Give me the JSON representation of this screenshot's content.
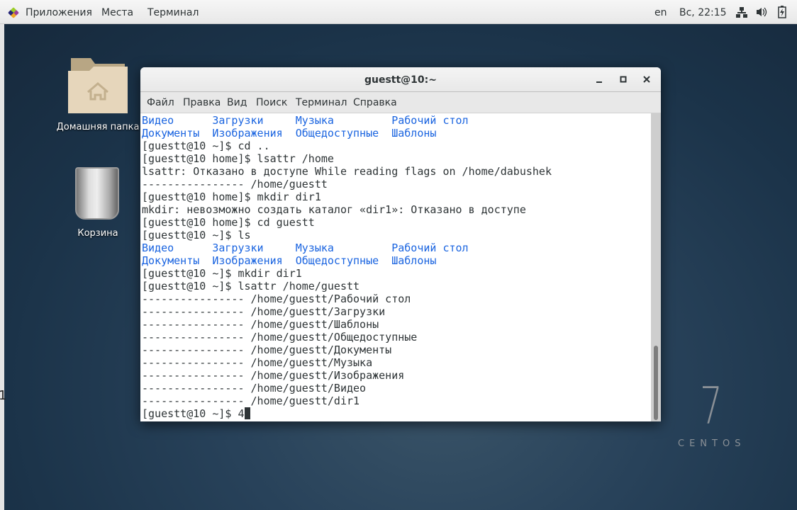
{
  "topbar": {
    "apps": "Приложения",
    "places": "Места",
    "terminal": "Терминал",
    "lang": "en",
    "clock": "Вс, 22:15"
  },
  "desktop": {
    "home_label": "Домашняя папка",
    "trash_label": "Корзина",
    "edge_text": "1",
    "centos_version": "7",
    "centos_text": "CENTOS"
  },
  "window": {
    "title": "guestt@10:~",
    "menu": [
      "Файл",
      "Правка",
      "Вид",
      "Поиск",
      "Терминал",
      "Справка"
    ],
    "lines": [
      {
        "text": "Видео      Загрузки     Музыка         Рабочий стол",
        "color": "blue"
      },
      {
        "text": "Документы  Изображения  Общедоступные  Шаблоны",
        "color": "blue"
      },
      {
        "text": "[guestt@10 ~]$ cd .."
      },
      {
        "text": "[guestt@10 home]$ lsattr /home"
      },
      {
        "text": "lsattr: Отказано в доступе While reading flags on /home/dabushek"
      },
      {
        "text": "---------------- /home/guestt"
      },
      {
        "text": "[guestt@10 home]$ mkdir dir1"
      },
      {
        "text": "mkdir: невозможно создать каталог «dir1»: Отказано в доступе"
      },
      {
        "text": "[guestt@10 home]$ cd guestt"
      },
      {
        "text": "[guestt@10 ~]$ ls"
      },
      {
        "text": "Видео      Загрузки     Музыка         Рабочий стол",
        "color": "blue"
      },
      {
        "text": "Документы  Изображения  Общедоступные  Шаблоны",
        "color": "blue"
      },
      {
        "text": "[guestt@10 ~]$ mkdir dir1"
      },
      {
        "text": "[guestt@10 ~]$ lsattr /home/guestt"
      },
      {
        "text": "---------------- /home/guestt/Рабочий стол"
      },
      {
        "text": "---------------- /home/guestt/Загрузки"
      },
      {
        "text": "---------------- /home/guestt/Шаблоны"
      },
      {
        "text": "---------------- /home/guestt/Общедоступные"
      },
      {
        "text": "---------------- /home/guestt/Документы"
      },
      {
        "text": "---------------- /home/guestt/Музыка"
      },
      {
        "text": "---------------- /home/guestt/Изображения"
      },
      {
        "text": "---------------- /home/guestt/Видео"
      },
      {
        "text": "---------------- /home/guestt/dir1"
      }
    ],
    "prompt": "[guestt@10 ~]$ ",
    "input": "4"
  },
  "colors": {
    "link_blue": "#1a64e0",
    "desktop": "#1b3349"
  }
}
